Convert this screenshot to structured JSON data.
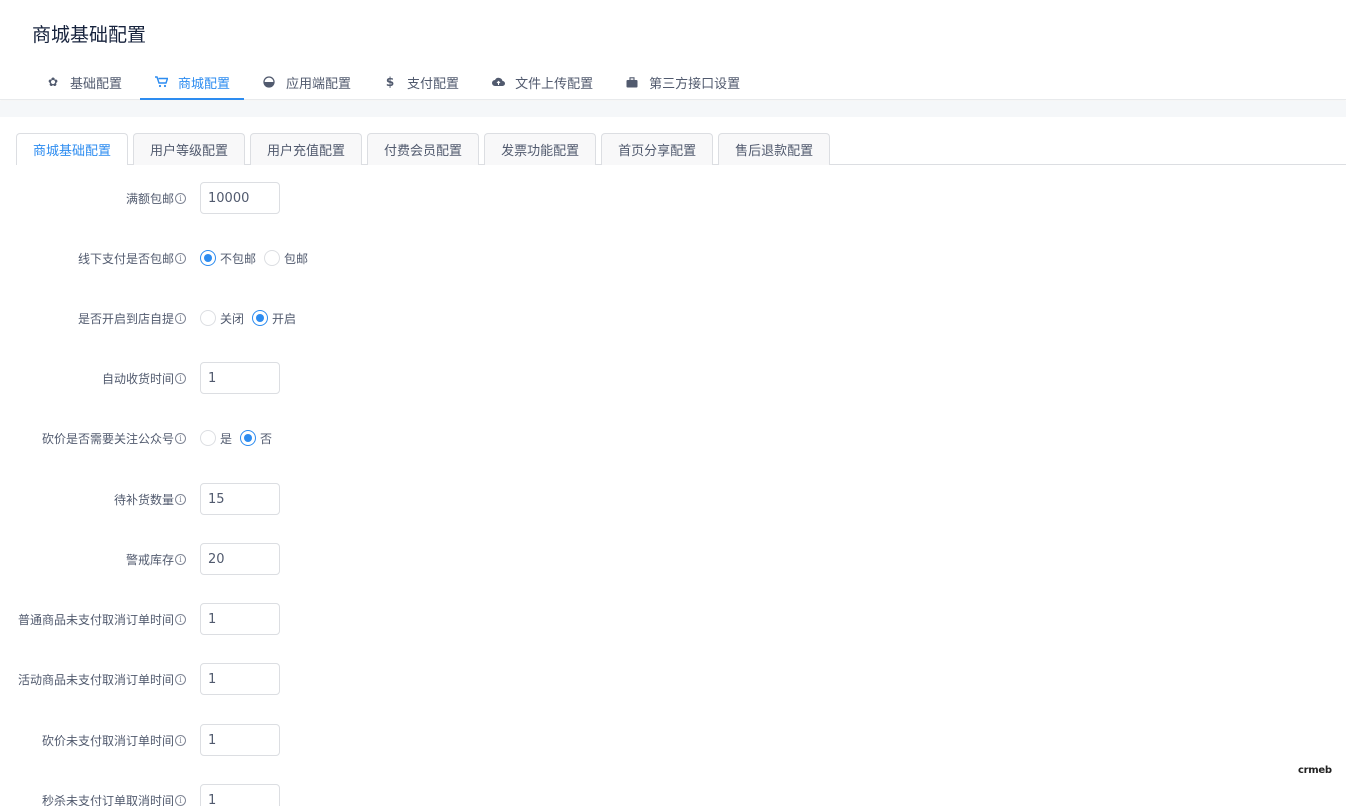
{
  "page_title": "商城基础配置",
  "top_tabs": [
    {
      "label": "基础配置",
      "icon": "gear-icon"
    },
    {
      "label": "商城配置",
      "icon": "cart-icon",
      "active": true
    },
    {
      "label": "应用端配置",
      "icon": "pie-icon"
    },
    {
      "label": "支付配置",
      "icon": "dollar-icon"
    },
    {
      "label": "文件上传配置",
      "icon": "cloud-upload-icon"
    },
    {
      "label": "第三方接口设置",
      "icon": "briefcase-icon"
    }
  ],
  "sub_tabs": [
    {
      "label": "商城基础配置",
      "active": true
    },
    {
      "label": "用户等级配置"
    },
    {
      "label": "用户充值配置"
    },
    {
      "label": "付费会员配置"
    },
    {
      "label": "发票功能配置"
    },
    {
      "label": "首页分享配置"
    },
    {
      "label": "售后退款配置"
    }
  ],
  "form": {
    "free_shipping_amount": {
      "label": "满额包邮",
      "value": "10000"
    },
    "offline_free_shipping": {
      "label": "线下支付是否包邮",
      "options": [
        "不包邮",
        "包邮"
      ],
      "selected": "不包邮"
    },
    "store_pickup": {
      "label": "是否开启到店自提",
      "options": [
        "关闭",
        "开启"
      ],
      "selected": "开启"
    },
    "auto_receive_time": {
      "label": "自动收货时间",
      "value": "1"
    },
    "bargain_follow": {
      "label": "砍价是否需要关注公众号",
      "options": [
        "是",
        "否"
      ],
      "selected": "否"
    },
    "restock_quantity": {
      "label": "待补货数量",
      "value": "15"
    },
    "warning_stock": {
      "label": "警戒库存",
      "value": "20"
    },
    "normal_unpaid_cancel": {
      "label": "普通商品未支付取消订单时间",
      "value": "1"
    },
    "activity_unpaid_cancel": {
      "label": "活动商品未支付取消订单时间",
      "value": "1"
    },
    "bargain_unpaid_cancel": {
      "label": "砍价未支付取消订单时间",
      "value": "1"
    },
    "seckill_unpaid_cancel": {
      "label": "秒杀未支付订单取消时间",
      "value": "1"
    }
  },
  "brand_logo": "crmeb",
  "colors": {
    "accent": "#2d8cf0",
    "border": "#dcdee2",
    "text": "#515a6e"
  }
}
